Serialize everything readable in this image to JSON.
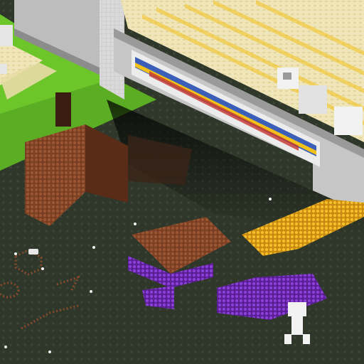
{
  "scene": {
    "kind": "isometric voxel stadium",
    "colors": {
      "field_green": "#6cc62a",
      "field_green_dark": "#4f9a1e",
      "ground_dark": "#2f372a",
      "ground_dot": "#3f4a38",
      "wall_light": "#d6d6d6",
      "wall_mid": "#b4b4b4",
      "wall_dark": "#8c8c8c",
      "floor_cream": "#efe5b8",
      "seat_yellow": "#f2c21b",
      "crowd_red": "#c4342e",
      "crowd_blue": "#3b5fb8",
      "wood_brown": "#8a4a2a",
      "wood_dark": "#5a2c17",
      "purple": "#7a2fc0",
      "gold": "#f0b21a",
      "white": "#f2f2f2"
    }
  }
}
